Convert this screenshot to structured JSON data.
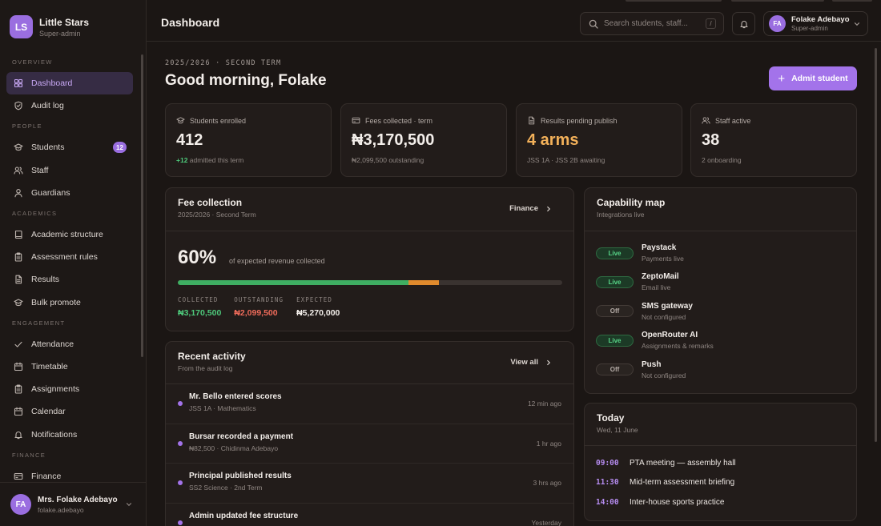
{
  "brand": {
    "initials": "LS",
    "name": "Little Stars",
    "role": "Super-admin"
  },
  "sidebar": {
    "sections": [
      {
        "label": "OVERVIEW",
        "items": [
          {
            "label": "Dashboard",
            "icon": "dashboard-icon",
            "active": true
          },
          {
            "label": "Audit log",
            "icon": "shield-icon"
          }
        ]
      },
      {
        "label": "PEOPLE",
        "items": [
          {
            "label": "Students",
            "icon": "graduation-cap-icon",
            "badge": "12"
          },
          {
            "label": "Staff",
            "icon": "users-icon"
          },
          {
            "label": "Guardians",
            "icon": "user-icon"
          }
        ]
      },
      {
        "label": "ACADEMICS",
        "items": [
          {
            "label": "Academic structure",
            "icon": "book-icon"
          },
          {
            "label": "Assessment rules",
            "icon": "clipboard-icon"
          },
          {
            "label": "Results",
            "icon": "file-text-icon"
          },
          {
            "label": "Bulk promote",
            "icon": "graduation-cap-icon"
          }
        ]
      },
      {
        "label": "ENGAGEMENT",
        "items": [
          {
            "label": "Attendance",
            "icon": "check-icon"
          },
          {
            "label": "Timetable",
            "icon": "calendar-icon"
          },
          {
            "label": "Assignments",
            "icon": "clipboard-icon"
          },
          {
            "label": "Calendar",
            "icon": "calendar-icon"
          },
          {
            "label": "Notifications",
            "icon": "bell-icon"
          }
        ]
      },
      {
        "label": "FINANCE",
        "items": [
          {
            "label": "Finance",
            "icon": "credit-card-icon"
          }
        ]
      }
    ]
  },
  "footer_user": {
    "initials": "FA",
    "name": "Mrs. Folake Adebayo",
    "handle": "folake.adebayo"
  },
  "topbar": {
    "title": "Dashboard",
    "search_placeholder": "Search students, staff...",
    "search_shortcut": "/",
    "user": {
      "initials": "FA",
      "name": "Folake Adebayo",
      "role": "Super-admin"
    }
  },
  "header": {
    "term": "2025/2026 · SECOND TERM",
    "greeting": "Good morning, Folake",
    "admit_button": "Admit student"
  },
  "stats": [
    {
      "label": "Students enrolled",
      "icon": "graduation-cap-icon",
      "value": "412",
      "sub_highlight": "+12",
      "sub": "admitted this term",
      "accent": "#f3eeea"
    },
    {
      "label": "Fees collected · term",
      "icon": "credit-card-icon",
      "value": "₦3,170,500",
      "sub_highlight": "",
      "sub": "₦2,099,500 outstanding",
      "accent": "#f3eeea"
    },
    {
      "label": "Results pending publish",
      "icon": "file-text-icon",
      "value": "4 arms",
      "sub_highlight": "",
      "sub": "JSS 1A · JSS 2B awaiting",
      "accent": "#f3b15a"
    },
    {
      "label": "Staff active",
      "icon": "users-icon",
      "value": "38",
      "sub_highlight": "",
      "sub": "2 onboarding",
      "accent": "#f3eeea"
    }
  ],
  "fee_collection": {
    "title": "Fee collection",
    "subtitle": "2025/2026 · Second Term",
    "link": "Finance",
    "percent": "60%",
    "caption": "of expected revenue collected",
    "collected_fraction": 0.6,
    "outstanding_fraction": 0.08,
    "collected_label": "COLLECTED",
    "collected_value": "₦3,170,500",
    "outstanding_label": "OUTSTANDING",
    "outstanding_value": "₦2,099,500",
    "expected_label": "EXPECTED",
    "expected_value": "₦5,270,000",
    "colors": {
      "collected": "#3fae62",
      "outstanding": "#e08a2d"
    }
  },
  "activity": {
    "title": "Recent activity",
    "subtitle": "From the audit log",
    "link": "View all",
    "items": [
      {
        "title": "Mr. Bello entered scores",
        "sub": "JSS 1A · Mathematics",
        "time": "12 min ago"
      },
      {
        "title": "Bursar recorded a payment",
        "sub": "₦82,500 · Chidinma Adebayo",
        "time": "1 hr ago"
      },
      {
        "title": "Principal published results",
        "sub": "SS2 Science · 2nd Term",
        "time": "3 hrs ago"
      },
      {
        "title": "Admin updated fee structure",
        "sub": "",
        "time": "Yesterday"
      }
    ]
  },
  "capabilities": {
    "title": "Capability map",
    "subtitle": "Integrations live",
    "items": [
      {
        "status": "Live",
        "live": true,
        "name": "Paystack",
        "desc": "Payments live"
      },
      {
        "status": "Live",
        "live": true,
        "name": "ZeptoMail",
        "desc": "Email live"
      },
      {
        "status": "Off",
        "live": false,
        "name": "SMS gateway",
        "desc": "Not configured"
      },
      {
        "status": "Live",
        "live": true,
        "name": "OpenRouter AI",
        "desc": "Assignments & remarks"
      },
      {
        "status": "Off",
        "live": false,
        "name": "Push",
        "desc": "Not configured"
      }
    ]
  },
  "today": {
    "title": "Today",
    "date": "Wed, 11 June",
    "events": [
      {
        "time": "09:00",
        "text": "PTA meeting — assembly hall"
      },
      {
        "time": "11:30",
        "text": "Mid-term assessment briefing"
      },
      {
        "time": "14:00",
        "text": "Inter-house sports practice"
      }
    ]
  }
}
